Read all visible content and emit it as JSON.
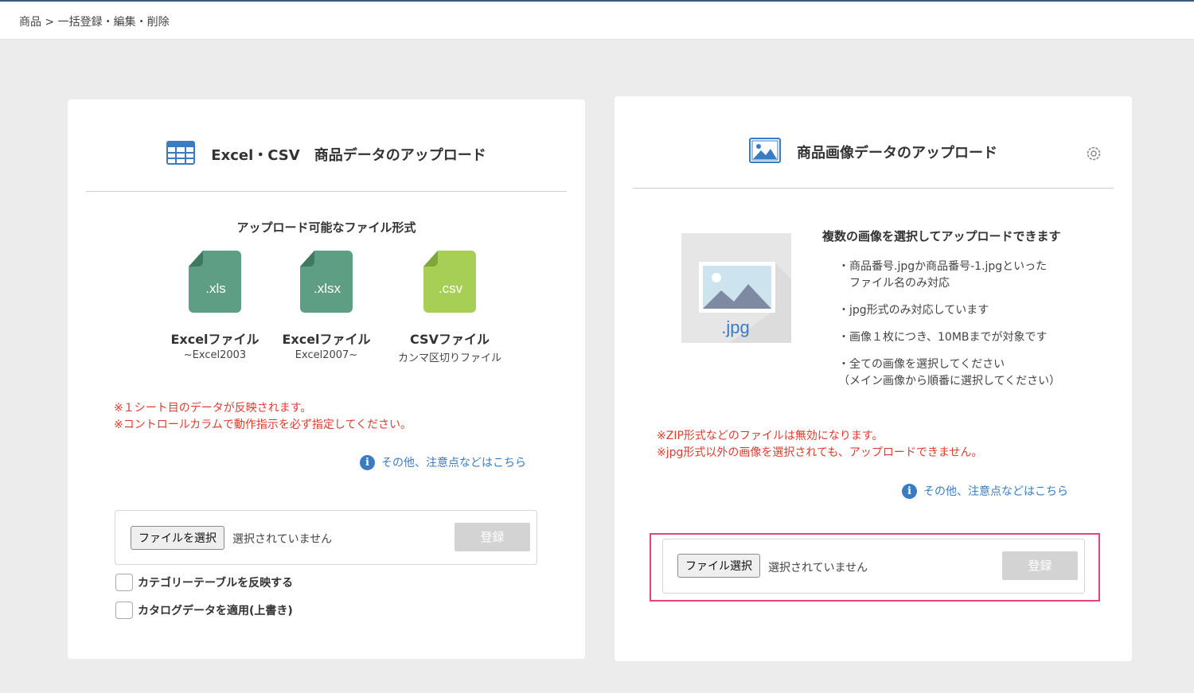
{
  "breadcrumb": "商品 > 一括登録・編集・削除",
  "left": {
    "title": "Excel・CSV　商品データのアップロード",
    "sub_title": "アップロード可能なファイル形式",
    "file_types": [
      {
        "ext": ".xls",
        "name": "Excelファイル",
        "desc": "~Excel2003",
        "color": "#5e9e85"
      },
      {
        "ext": ".xlsx",
        "name": "Excelファイル",
        "desc": "Excel2007~",
        "color": "#5e9e85"
      },
      {
        "ext": ".csv",
        "name": "CSVファイル",
        "desc": "カンマ区切りファイル",
        "color": "#a8cf55"
      }
    ],
    "notes": [
      "※１シート目のデータが反映されます。",
      "※コントロールカラムで動作指示を必ず指定してください。"
    ],
    "info_link": "その他、注意点などはこちら",
    "file_button": "ファイルを選択",
    "file_status": "選択されていません",
    "submit": "登録",
    "checkboxes": [
      "カテゴリーテーブルを反映する",
      "カタログデータを適用(上書き)"
    ]
  },
  "right": {
    "title": "商品画像データのアップロード",
    "image_label": ".jpg",
    "sub_title": "複数の画像を選択してアップロードできます",
    "bullets": [
      [
        "・商品番号.jpgか商品番号-1.jpgといった",
        "　ファイル名のみ対応"
      ],
      [
        "・jpg形式のみ対応しています"
      ],
      [
        "・画像１枚につき、10MBまでが対象です"
      ],
      [
        "・全ての画像を選択してください",
        "（メイン画像から順番に選択してください）"
      ]
    ],
    "notes": [
      "※ZIP形式などのファイルは無効になります。",
      "※jpg形式以外の画像を選択されても、アップロードできません。"
    ],
    "info_link": "その他、注意点などはこちら",
    "file_button": "ファイル選択",
    "file_status": "選択されていません",
    "submit": "登録"
  },
  "colors": {
    "accent": "#3a7cc1",
    "warning": "#e03b2e",
    "highlight": "#e0457b"
  }
}
